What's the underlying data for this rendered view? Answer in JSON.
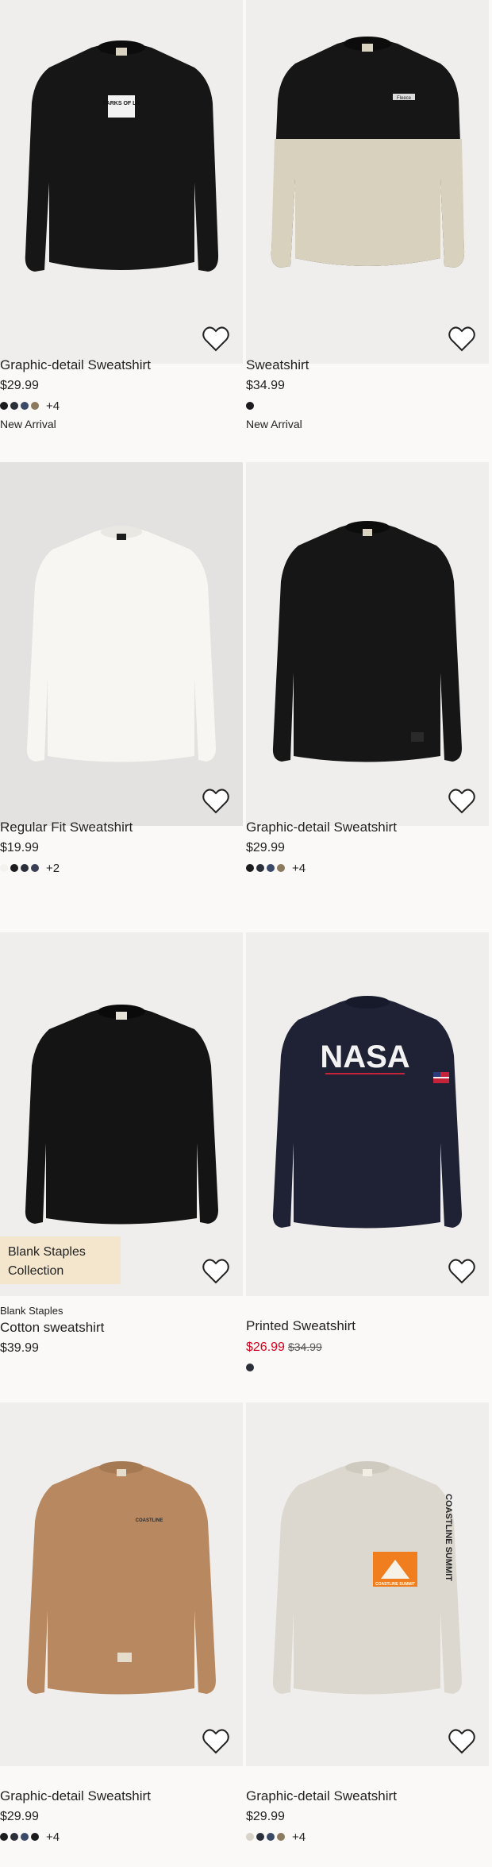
{
  "products": [
    {
      "title": "Graphic-detail Sweatshirt",
      "price": "$29.99",
      "swatches": [
        "#1c1c1e",
        "#2b2f3a",
        "#3a4a66",
        "#8c7a5e"
      ],
      "more": "+4",
      "marker": "New Arrival",
      "fav_label": "Add to favourites"
    },
    {
      "title": "Sweatshirt",
      "price": "$34.99",
      "swatches": [
        "#1c1c1e"
      ],
      "more": "",
      "marker": "New Arrival",
      "fav_label": "Add to favourites"
    },
    {
      "title": "Regular Fit Sweatshirt",
      "price": "$19.99",
      "swatches": [
        "#f4f2ee",
        "#1c1c1e",
        "#2b2f3a",
        "#3a3f55"
      ],
      "more": "+2",
      "marker": "",
      "fav_label": "Add to favourites"
    },
    {
      "title": "Graphic-detail Sweatshirt",
      "price": "$29.99",
      "swatches": [
        "#1c1c1e",
        "#2b2f3a",
        "#3a4a66",
        "#8c7a5e"
      ],
      "more": "+4",
      "marker": "",
      "fav_label": "Add to favourites"
    },
    {
      "brand": "Blank Staples",
      "title": "Cotton sweatshirt",
      "price": "$39.99",
      "promo": "Blank Staples Collection",
      "swatches": [],
      "more": "",
      "fav_label": "Add to favourites"
    },
    {
      "title": "Printed Sweatshirt",
      "sale_price": "$26.99",
      "was_price": "$34.99",
      "swatches": [
        "#2b2f3a"
      ],
      "more": "",
      "fav_label": "Add to favourites"
    },
    {
      "title": "Graphic-detail Sweatshirt",
      "price": "$29.99",
      "swatches": [
        "#1c1c1e",
        "#2b2f3a",
        "#3a4a66",
        "#1c1c1e"
      ],
      "more": "+4",
      "fav_label": "Add to favourites"
    },
    {
      "title": "Graphic-detail Sweatshirt",
      "price": "$29.99",
      "swatches": [
        "#d8d3c8",
        "#2b2f3a",
        "#3a4a66",
        "#8c7a5e"
      ],
      "more": "+4",
      "fav_label": "Add to favourites"
    }
  ],
  "graphics": {
    "p1_print": "PARKS OF LA",
    "p2_print": "Fleece",
    "p6_print": "NASA",
    "p8_print_side": "COASTLINE SUMMIT",
    "p8_print_box": "COASTLINE SUMMIT",
    "p7_print": "COASTLINE"
  },
  "colors": {
    "sale": "#d6001c",
    "promo_bg": "#f3e6cc",
    "image_bg": "#eeeeee",
    "page_bg": "#faf9f8"
  }
}
